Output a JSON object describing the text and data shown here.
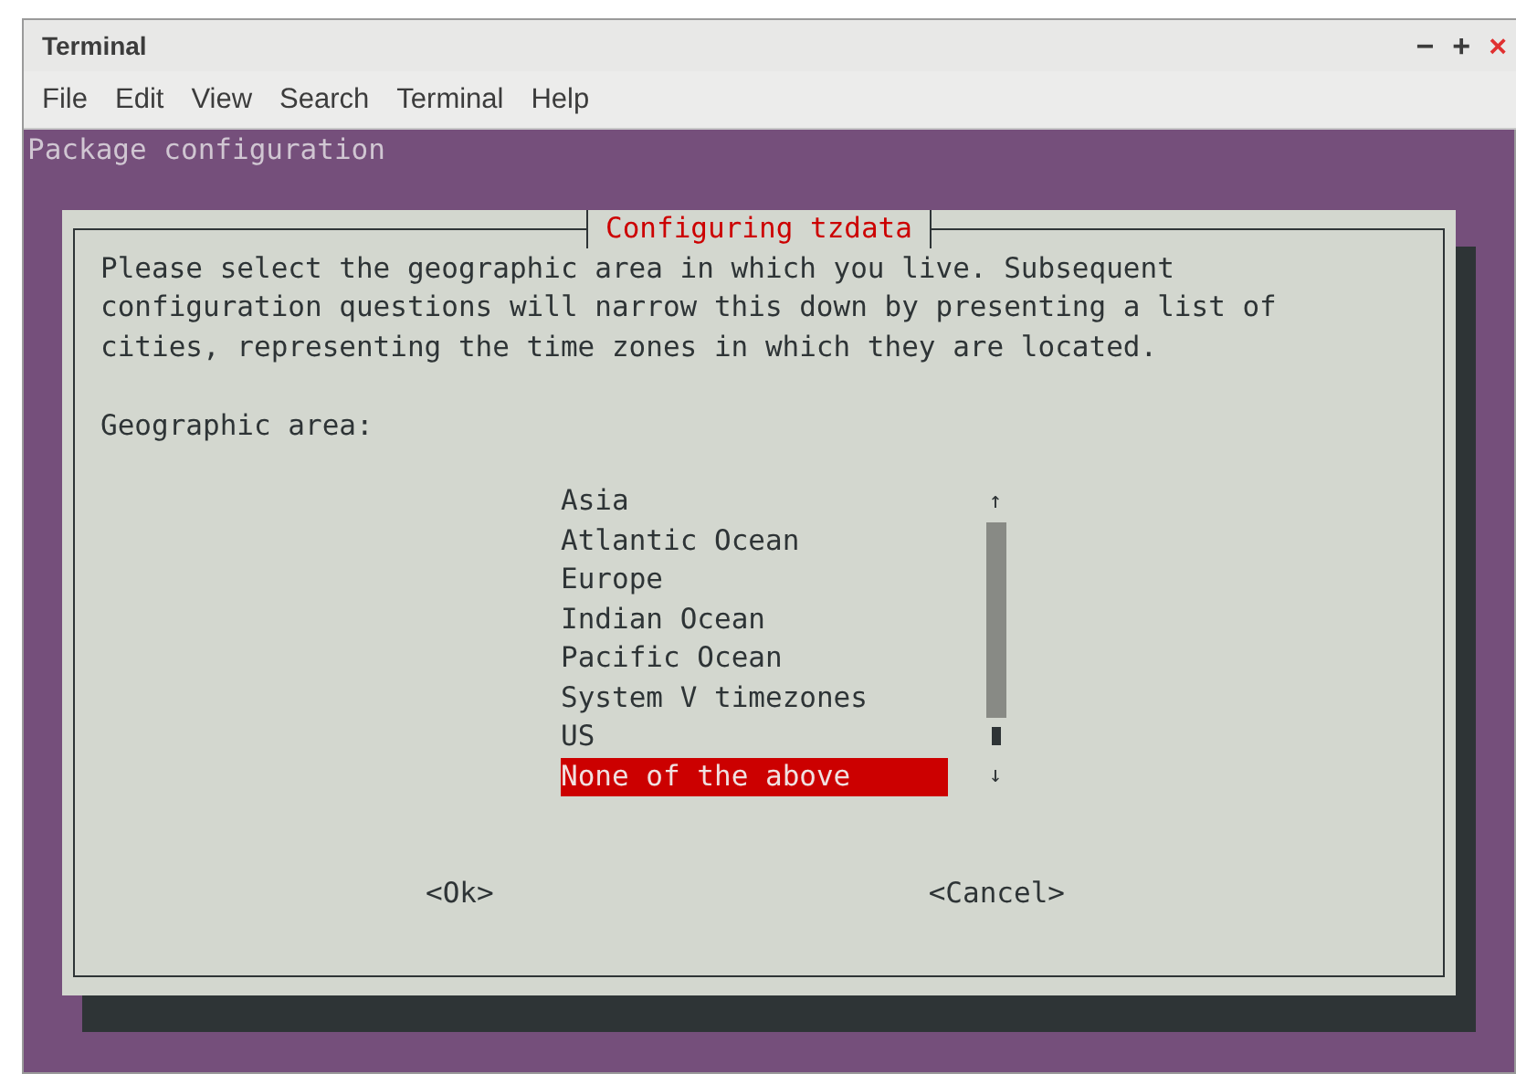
{
  "window": {
    "title": "Terminal",
    "controls": [
      "−",
      "+",
      "×"
    ]
  },
  "menu": [
    "File",
    "Edit",
    "View",
    "Search",
    "Terminal",
    "Help"
  ],
  "terminal": {
    "heading": "Package configuration"
  },
  "dialog": {
    "title": "Configuring tzdata",
    "message": [
      "Please select the geographic area in which you live. Subsequent",
      "configuration questions will narrow this down by presenting a list of",
      "cities, representing the time zones in which they are located."
    ],
    "label": "Geographic area:",
    "areas": [
      {
        "label": "Asia",
        "selected": false
      },
      {
        "label": "Atlantic Ocean",
        "selected": false
      },
      {
        "label": "Europe",
        "selected": false
      },
      {
        "label": "Indian Ocean",
        "selected": false
      },
      {
        "label": "Pacific Ocean",
        "selected": false
      },
      {
        "label": "System V timezones",
        "selected": false
      },
      {
        "label": "US",
        "selected": false
      },
      {
        "label": "None of the above",
        "selected": true
      }
    ],
    "scroll_up": "↑",
    "scroll_down": "↓",
    "buttons": [
      "<Ok>",
      "<Cancel>"
    ]
  }
}
